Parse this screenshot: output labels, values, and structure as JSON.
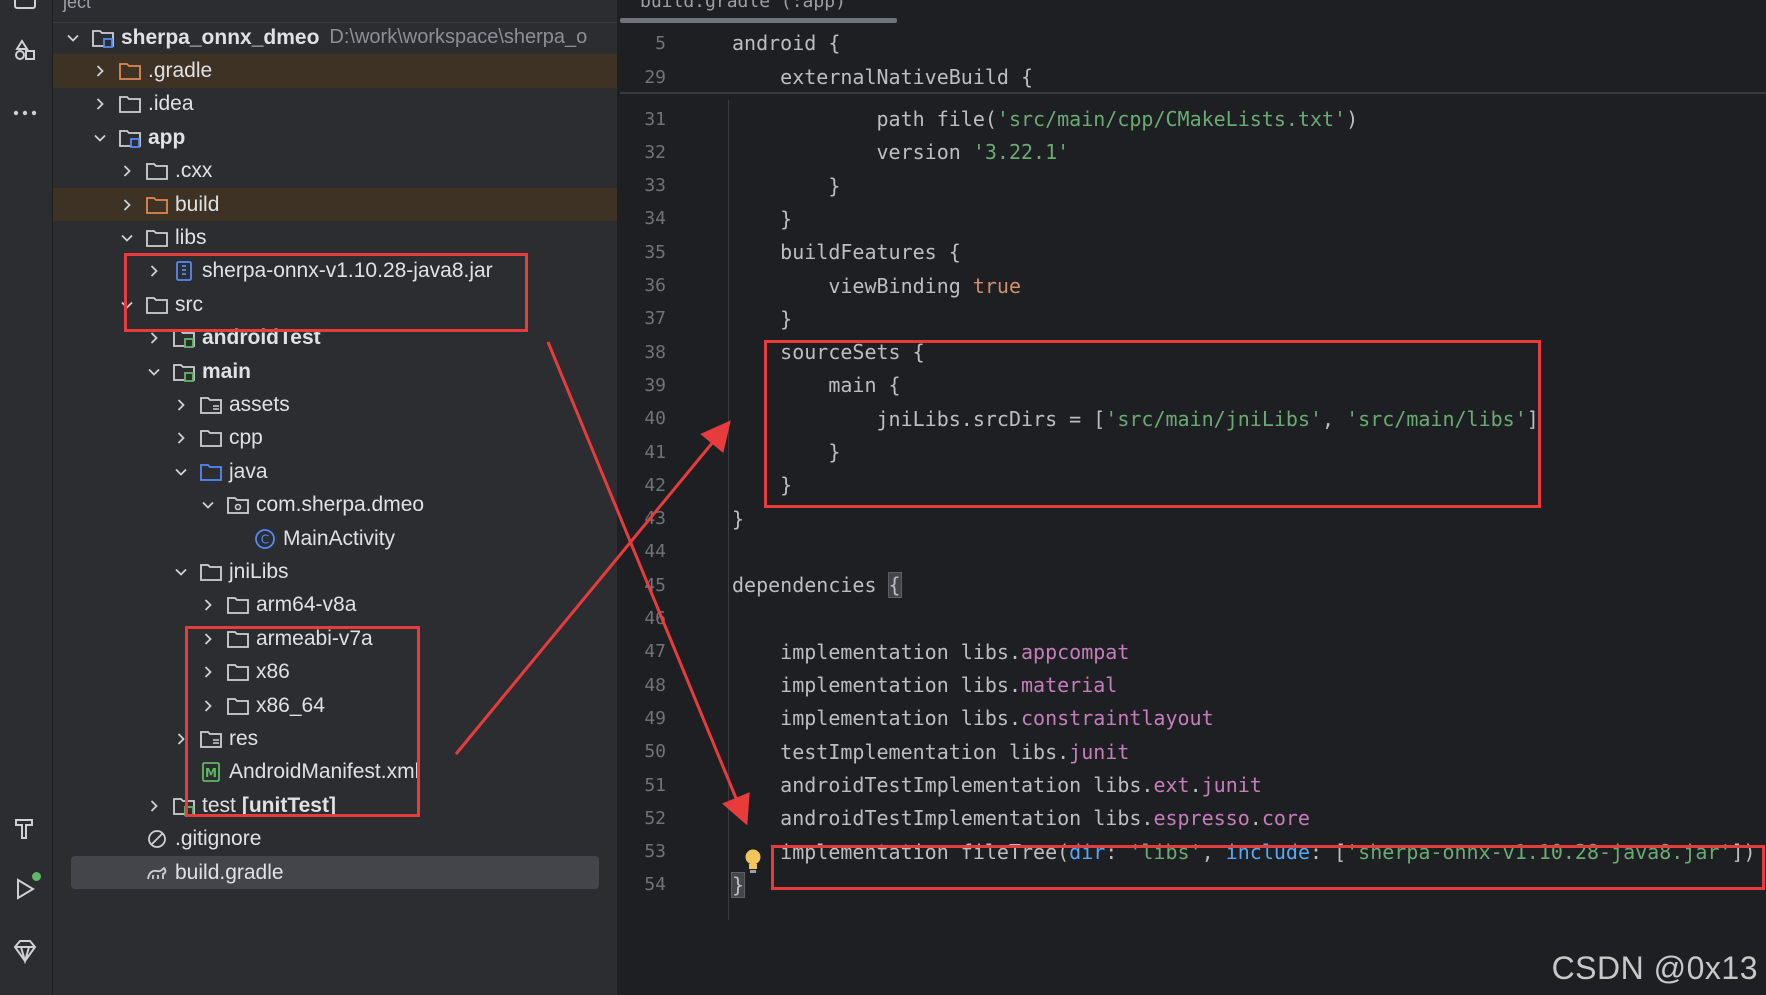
{
  "panel": {
    "header_title": "ject"
  },
  "editor": {
    "tab_label": "build.gradle (:app)",
    "code": [
      {
        "n": "5",
        "segs": [
          {
            "t": "android {",
            "c": "plain"
          }
        ]
      },
      {
        "n": "29",
        "segs": [
          {
            "t": "    externalNativeBuild {",
            "c": "plain"
          }
        ]
      },
      {
        "n": "31",
        "segs": [
          {
            "t": "            path file(",
            "c": "plain"
          },
          {
            "t": "'src/main/cpp/CMakeLists.txt'",
            "c": "str"
          },
          {
            "t": ")",
            "c": "plain"
          }
        ]
      },
      {
        "n": "32",
        "segs": [
          {
            "t": "            version ",
            "c": "plain"
          },
          {
            "t": "'3.22.1'",
            "c": "str"
          }
        ]
      },
      {
        "n": "33",
        "segs": [
          {
            "t": "        }",
            "c": "plain"
          }
        ]
      },
      {
        "n": "34",
        "segs": [
          {
            "t": "    }",
            "c": "plain"
          }
        ]
      },
      {
        "n": "35",
        "segs": [
          {
            "t": "    buildFeatures {",
            "c": "plain"
          }
        ]
      },
      {
        "n": "36",
        "segs": [
          {
            "t": "        viewBinding ",
            "c": "plain"
          },
          {
            "t": "true",
            "c": "kw"
          }
        ]
      },
      {
        "n": "37",
        "segs": [
          {
            "t": "    }",
            "c": "plain"
          }
        ]
      },
      {
        "n": "38",
        "segs": [
          {
            "t": "    sourceSets {",
            "c": "plain"
          }
        ]
      },
      {
        "n": "39",
        "segs": [
          {
            "t": "        main {",
            "c": "plain"
          }
        ]
      },
      {
        "n": "40",
        "segs": [
          {
            "t": "            jniLibs.srcDirs = [",
            "c": "plain"
          },
          {
            "t": "'src/main/jniLibs'",
            "c": "str"
          },
          {
            "t": ", ",
            "c": "plain"
          },
          {
            "t": "'src/main/libs'",
            "c": "str"
          },
          {
            "t": "]",
            "c": "plain"
          }
        ]
      },
      {
        "n": "41",
        "segs": [
          {
            "t": "        }",
            "c": "plain"
          }
        ]
      },
      {
        "n": "42",
        "segs": [
          {
            "t": "    }",
            "c": "plain"
          }
        ]
      },
      {
        "n": "43",
        "segs": [
          {
            "t": "}",
            "c": "plain"
          }
        ]
      },
      {
        "n": "44",
        "segs": []
      },
      {
        "n": "45",
        "segs": [
          {
            "t": "dependencies ",
            "c": "plain"
          },
          {
            "t": "{",
            "c": "caret"
          }
        ]
      },
      {
        "n": "46",
        "segs": []
      },
      {
        "n": "47",
        "segs": [
          {
            "t": "    implementation libs.",
            "c": "plain"
          },
          {
            "t": "appcompat",
            "c": "prop"
          }
        ]
      },
      {
        "n": "48",
        "segs": [
          {
            "t": "    implementation libs.",
            "c": "plain"
          },
          {
            "t": "material",
            "c": "prop"
          }
        ]
      },
      {
        "n": "49",
        "segs": [
          {
            "t": "    implementation libs.",
            "c": "plain"
          },
          {
            "t": "constraintlayout",
            "c": "prop"
          }
        ]
      },
      {
        "n": "50",
        "segs": [
          {
            "t": "    testImplementation libs.",
            "c": "plain"
          },
          {
            "t": "junit",
            "c": "prop"
          }
        ]
      },
      {
        "n": "51",
        "segs": [
          {
            "t": "    androidTestImplementation libs.",
            "c": "plain"
          },
          {
            "t": "ext",
            "c": "prop"
          },
          {
            "t": ".",
            "c": "plain"
          },
          {
            "t": "junit",
            "c": "prop"
          }
        ]
      },
      {
        "n": "52",
        "segs": [
          {
            "t": "    androidTestImplementation libs.",
            "c": "plain"
          },
          {
            "t": "espresso",
            "c": "prop"
          },
          {
            "t": ".",
            "c": "plain"
          },
          {
            "t": "core",
            "c": "prop"
          }
        ]
      },
      {
        "n": "53",
        "segs": [
          {
            "t": "    implementation fileTree(",
            "c": "plain"
          },
          {
            "t": "dir",
            "c": "param"
          },
          {
            "t": ": ",
            "c": "plain"
          },
          {
            "t": "'libs'",
            "c": "str"
          },
          {
            "t": ", ",
            "c": "plain"
          },
          {
            "t": "include",
            "c": "param"
          },
          {
            "t": ": [",
            "c": "plain"
          },
          {
            "t": "'sherpa-onnx-v1.10.28-java8.jar'",
            "c": "str"
          },
          {
            "t": "])",
            "c": "plain"
          }
        ]
      },
      {
        "n": "54",
        "segs": [
          {
            "t": "}",
            "c": "caret"
          }
        ]
      }
    ]
  },
  "tree": [
    {
      "label": "sherpa_onnx_dmeo",
      "hint": "D:\\work\\workspace\\sherpa_o",
      "depth": 0,
      "chev": "down",
      "icon": "module-folder-icon",
      "bold": true
    },
    {
      "label": ".gradle",
      "depth": 1,
      "chev": "right",
      "icon": "excluded-folder-icon",
      "row": "excluded"
    },
    {
      "label": ".idea",
      "depth": 1,
      "chev": "right",
      "icon": "folder-icon"
    },
    {
      "label": "app",
      "depth": 1,
      "chev": "down",
      "icon": "module-folder-icon",
      "bold": true
    },
    {
      "label": ".cxx",
      "depth": 2,
      "chev": "right",
      "icon": "folder-icon"
    },
    {
      "label": "build",
      "depth": 2,
      "chev": "right",
      "icon": "excluded-folder-icon",
      "row": "excluded"
    },
    {
      "label": "libs",
      "depth": 2,
      "chev": "down",
      "icon": "folder-icon"
    },
    {
      "label": "sherpa-onnx-v1.10.28-java8.jar",
      "depth": 3,
      "chev": "right",
      "icon": "jar-icon"
    },
    {
      "label": "src",
      "depth": 2,
      "chev": "down",
      "icon": "folder-icon"
    },
    {
      "label": "androidTest",
      "depth": 3,
      "chev": "right",
      "icon": "test-folder-icon",
      "bold": true
    },
    {
      "label": "main",
      "depth": 3,
      "chev": "down",
      "icon": "test-folder-icon",
      "bold": true
    },
    {
      "label": "assets",
      "depth": 4,
      "chev": "right",
      "icon": "resource-folder-icon"
    },
    {
      "label": "cpp",
      "depth": 4,
      "chev": "right",
      "icon": "folder-icon"
    },
    {
      "label": "java",
      "depth": 4,
      "chev": "down",
      "icon": "source-folder-icon"
    },
    {
      "label": "com.sherpa.dmeo",
      "depth": 5,
      "chev": "down",
      "icon": "package-icon"
    },
    {
      "label": "MainActivity",
      "depth": 6,
      "chev": "none",
      "icon": "class-icon"
    },
    {
      "label": "jniLibs",
      "depth": 4,
      "chev": "down",
      "icon": "folder-icon"
    },
    {
      "label": "arm64-v8a",
      "depth": 5,
      "chev": "right",
      "icon": "folder-icon"
    },
    {
      "label": "armeabi-v7a",
      "depth": 5,
      "chev": "right",
      "icon": "folder-icon"
    },
    {
      "label": "x86",
      "depth": 5,
      "chev": "right",
      "icon": "folder-icon"
    },
    {
      "label": "x86_64",
      "depth": 5,
      "chev": "right",
      "icon": "folder-icon"
    },
    {
      "label": "res",
      "depth": 4,
      "chev": "right",
      "icon": "resource-folder-icon"
    },
    {
      "label": "AndroidManifest.xml",
      "depth": 4,
      "chev": "none",
      "icon": "manifest-icon"
    },
    {
      "label": "test",
      "suffix": "[unitTest]",
      "depth": 3,
      "chev": "right",
      "icon": "test-folder-icon"
    },
    {
      "label": ".gitignore",
      "depth": 2,
      "chev": "none",
      "icon": "ignore-icon"
    },
    {
      "label": "build.gradle",
      "depth": 2,
      "chev": "none",
      "icon": "gradle-icon",
      "row": "selected"
    }
  ],
  "watermark": "CSDN @0x13",
  "colors": {
    "highlight": "#e83c3c",
    "string": "#6aab73",
    "keyword": "#cf8e6d",
    "property": "#c77dbb",
    "param": "#56a8f5"
  }
}
